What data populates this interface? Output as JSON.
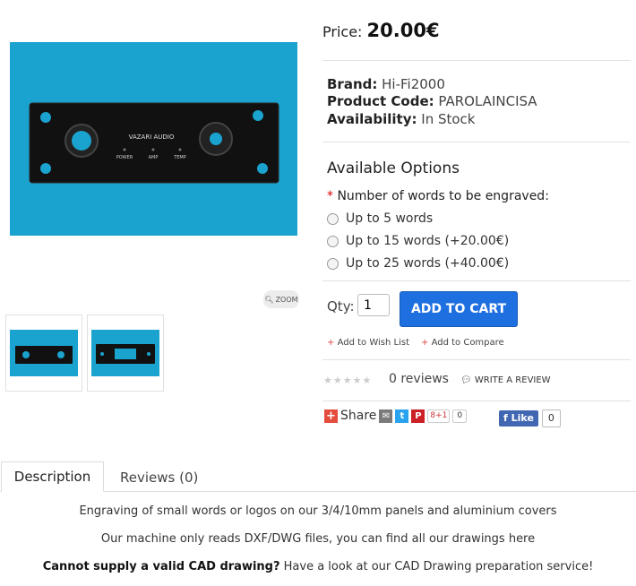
{
  "price": {
    "label": "Price:",
    "value": "20.00€"
  },
  "product_image": {
    "brand_text": "VAZARI AUDIO",
    "labels": [
      "POWER",
      "AMP",
      "TEMP"
    ]
  },
  "zoom_label": "ZOOM",
  "details": {
    "brand_label": "Brand:",
    "brand_value": "Hi-Fi2000",
    "code_label": "Product Code:",
    "code_value": "PAROLAINCISA",
    "availability_label": "Availability:",
    "availability_value": "In Stock"
  },
  "options": {
    "title": "Available Options",
    "required_mark": "*",
    "field_label": "Number of words to be engraved:",
    "choices": [
      "Up to 5 words",
      "Up to 15 words (+20.00€)",
      "Up to 25 words (+40.00€)"
    ]
  },
  "cart": {
    "qty_label": "Qty:",
    "qty_value": "1",
    "button_label": "ADD TO CART"
  },
  "links": {
    "wishlist": "Add to Wish List",
    "compare": "Add to Compare"
  },
  "rating": {
    "stars": 0,
    "stars_text": "★★★★★",
    "reviews_count": "0 reviews",
    "write_review": "WRITE A REVIEW"
  },
  "share": {
    "label": "Share",
    "gplus": "8+1",
    "gplus_count": "0",
    "fb_like": "Like",
    "fb_count": "0"
  },
  "tabs": [
    {
      "label": "Description",
      "active": true
    },
    {
      "label": "Reviews (0)",
      "active": false
    }
  ],
  "description": {
    "line1": "Engraving of small words or logos on our 3/4/10mm panels and aluminium covers",
    "line2": "Our machine only reads DXF/DWG files, you can find all our drawings here",
    "line3_bold": "Cannot supply a valid CAD drawing?",
    "line3_rest": " Have a look at our CAD Drawing preparation service!"
  }
}
